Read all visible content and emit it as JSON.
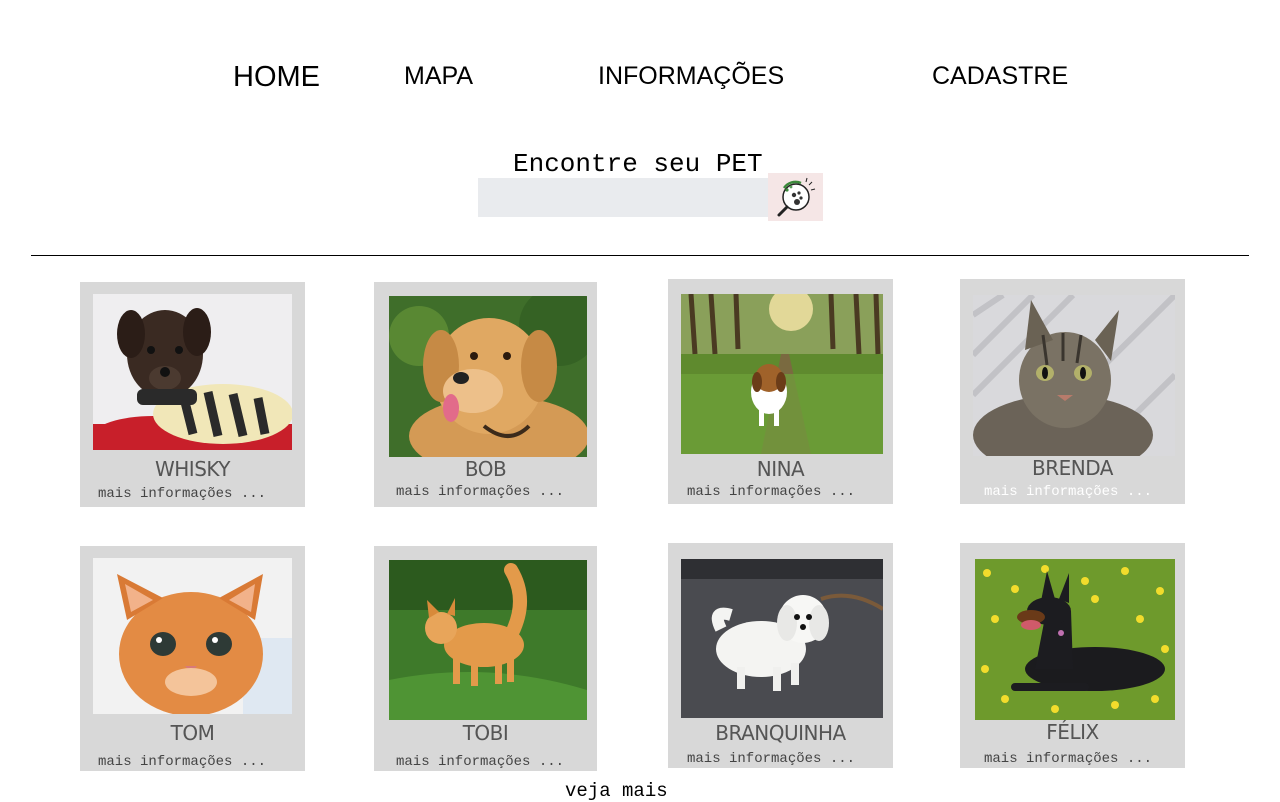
{
  "nav": {
    "home": "HOME",
    "map": "MAPA",
    "info": "INFORMAÇÕES",
    "signup": "CADASTRE"
  },
  "search": {
    "title": "Encontre seu PET",
    "placeholder": "",
    "value": "",
    "button_icon": "magnifier-paw-icon"
  },
  "pets": [
    {
      "name": "WHISKY",
      "more": "mais informações ...",
      "photo": "puppy-in-sweater"
    },
    {
      "name": "BOB",
      "more": "mais informações ...",
      "photo": "golden-retriever"
    },
    {
      "name": "NINA",
      "more": "mais informações ...",
      "photo": "beagle-on-trail"
    },
    {
      "name": "BRENDA",
      "more": "mais informações ...",
      "photo": "tabby-cat"
    },
    {
      "name": "TOM",
      "more": "mais informações ...",
      "photo": "orange-kitten"
    },
    {
      "name": "TOBI",
      "more": "mais informações ...",
      "photo": "kitten-on-grass"
    },
    {
      "name": "BRANQUINHA",
      "more": "mais informações ...",
      "photo": "white-maltese"
    },
    {
      "name": "FÉLIX",
      "more": "mais informações ...",
      "photo": "doberman-in-flowers"
    }
  ],
  "see_more": "veja mais"
}
